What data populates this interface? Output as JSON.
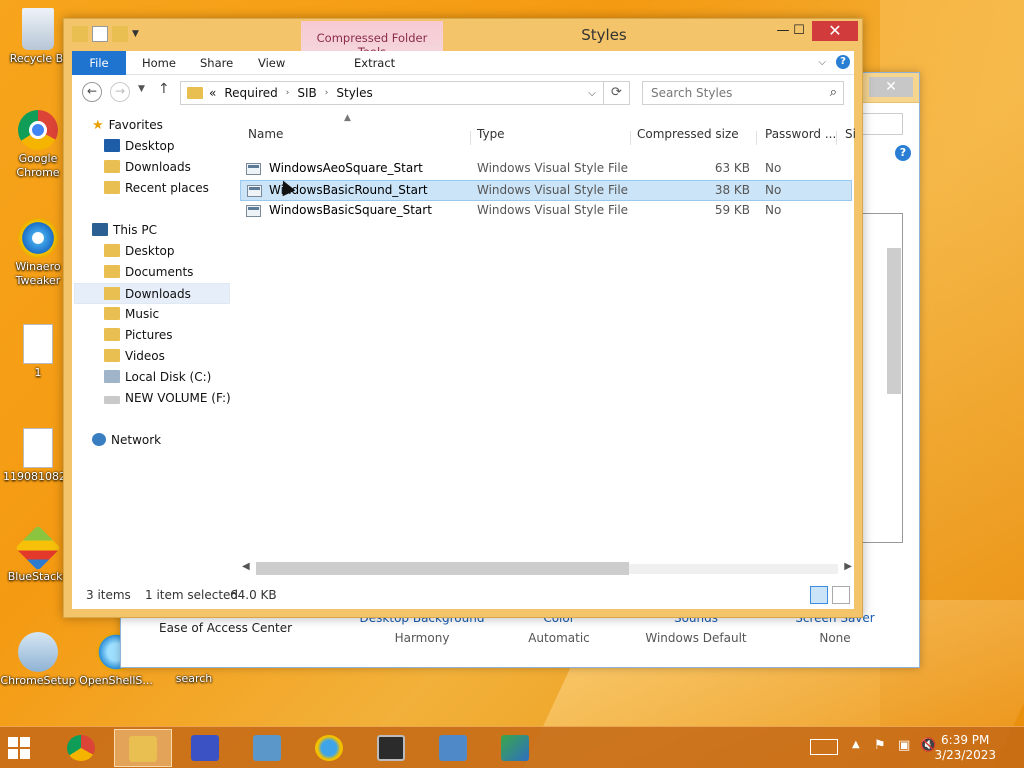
{
  "desktop": {
    "icons": [
      {
        "label": "Recycle Bi",
        "icon": "recycle-bin-icon"
      },
      {
        "label": "Google Chrome",
        "icon": "chrome-icon"
      },
      {
        "label": "Winaero Tweaker",
        "icon": "winaero-icon"
      },
      {
        "label": "1",
        "icon": "document-icon"
      },
      {
        "label": "1190810828",
        "icon": "document-icon"
      },
      {
        "label": "BlueStacks",
        "icon": "bluestacks-icon"
      },
      {
        "label": "ChromeSetup",
        "icon": "setup-icon"
      },
      {
        "label": "OpenShellS...",
        "icon": "openshell-icon"
      },
      {
        "label": "search",
        "icon": "search-icon"
      }
    ]
  },
  "control_panel": {
    "ease_label": "Ease of Access Center",
    "items": [
      {
        "label": "Desktop Background",
        "value": "Harmony"
      },
      {
        "label": "Color",
        "value": "Automatic"
      },
      {
        "label": "Sounds",
        "value": "Windows Default"
      },
      {
        "label": "Screen Saver",
        "value": "None"
      }
    ],
    "close_glyph": "✕"
  },
  "explorer": {
    "title": "Styles",
    "context_tab": "Compressed Folder Tools",
    "ribbon_tabs": {
      "file": "File",
      "home": "Home",
      "share": "Share",
      "view": "View",
      "extract": "Extract"
    },
    "window_buttons": {
      "minimize": "—",
      "maximize": "☐",
      "close": "✕"
    },
    "address": {
      "overflow": "«",
      "crumbs": [
        "Required",
        "SIB",
        "Styles"
      ]
    },
    "search_placeholder": "Search Styles",
    "nav": {
      "favorites": "Favorites",
      "fav_items": [
        "Desktop",
        "Downloads",
        "Recent places"
      ],
      "this_pc": "This PC",
      "pc_items": [
        "Desktop",
        "Documents",
        "Downloads",
        "Music",
        "Pictures",
        "Videos",
        "Local Disk (C:)",
        "NEW VOLUME (F:)"
      ],
      "network": "Network"
    },
    "columns": {
      "name": "Name",
      "type": "Type",
      "size": "Compressed size",
      "password": "Password ...",
      "extra": "Si"
    },
    "files": [
      {
        "name": "WindowsAeoSquare_Start",
        "type": "Windows Visual Style File",
        "size": "63 KB",
        "password": "No"
      },
      {
        "name": "WindowsBasicRound_Start",
        "type": "Windows Visual Style File",
        "size": "38 KB",
        "password": "No"
      },
      {
        "name": "WindowsBasicSquare_Start",
        "type": "Windows Visual Style File",
        "size": "59 KB",
        "password": "No"
      }
    ],
    "status": {
      "count": "3 items",
      "selected": "1 item selected",
      "size": "64.0 KB"
    }
  },
  "taskbar": {
    "time": "6:39 PM",
    "date": "3/23/2023"
  }
}
